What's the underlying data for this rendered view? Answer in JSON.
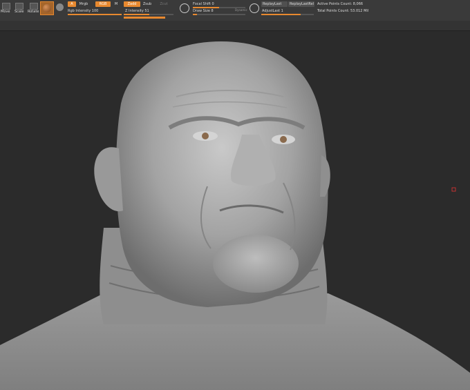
{
  "toolbar": {
    "edit_label": "Edit",
    "draw_label": "Draw",
    "move_label": "Move",
    "scale_label": "Scale",
    "rotate_label": "Rotate",
    "a_label": "A",
    "mrgb_label": "Mrgb",
    "rgb_label": "RGB",
    "m_label": "M",
    "rgb_intensity": "Rgb Intensity 100",
    "zadd_label": "Zadd",
    "zsub_label": "Zsub",
    "zcut_label": "Zcut",
    "z_intensity": "Z Intensity 51",
    "focal_shift": "Focal Shift 0",
    "draw_size": "Draw Size 8",
    "dynamic_label": "Dynamic",
    "replay_last": "ReplayLast",
    "replay_last_rel": "ReplayLastRel",
    "adjust_last": "AdjustLast 1",
    "active_points": "Active Points Count: 8,066",
    "total_points": "Total Points Count: 53.012 Mil"
  },
  "colors": {
    "accent": "#e8892f",
    "background": "#2b2b2b",
    "toolbar": "#3a3a3a",
    "clay": "#a8a8a8"
  },
  "icons": [
    "move-icon",
    "scale-icon",
    "rotate-icon",
    "material-sphere-icon",
    "brush-icon",
    "focal-icon",
    "adjust-icon"
  ]
}
